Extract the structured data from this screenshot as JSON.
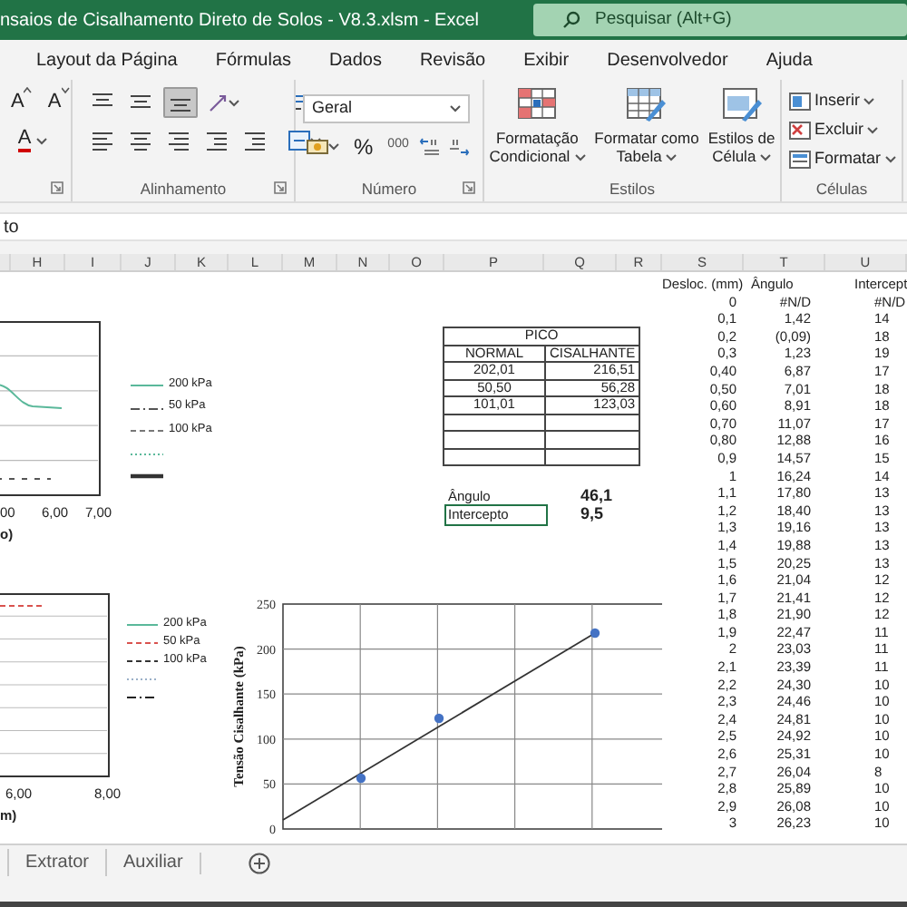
{
  "title_bar": {
    "title": "nsaios de Cisalhamento Direto de Solos - V8.3.xlsm  -  Excel",
    "search_placeholder": "Pesquisar (Alt+G)"
  },
  "ribbon_tabs": [
    "Layout da Página",
    "Fórmulas",
    "Dados",
    "Revisão",
    "Exibir",
    "Desenvolvedor",
    "Ajuda"
  ],
  "ribbon": {
    "font": {
      "grow": "A",
      "shrink": "A",
      "font_color_button": "A"
    },
    "alignment": {
      "vertical": [
        {
          "kind": "top",
          "selected": false
        },
        {
          "kind": "middle",
          "selected": false
        },
        {
          "kind": "bottom",
          "selected": true
        }
      ],
      "label": "Alinhamento"
    },
    "number": {
      "format": "Geral",
      "percent": "%",
      "thousands": "000",
      "label": "Número"
    },
    "styles": {
      "buttons": [
        "Formatação Condicional",
        "Formatar como Tabela",
        "Estilos de Célula"
      ],
      "label": "Estilos"
    },
    "cells": {
      "buttons": [
        "Inserir",
        "Excluir",
        "Formatar"
      ],
      "label": "Células"
    }
  },
  "formula_bar": {
    "value": "to"
  },
  "column_headers": [
    "H",
    "I",
    "J",
    "K",
    "L",
    "M",
    "N",
    "O",
    "P",
    "Q",
    "R",
    "S",
    "T",
    "U"
  ],
  "chart_top_left": {
    "x_tick_labels": [
      "00",
      "6,00",
      "7,00"
    ],
    "axis_label": "o)",
    "legend": [
      {
        "label": "200 kPa",
        "kind": "solid",
        "color": "#5ab89a"
      },
      {
        "label": "50 kPa",
        "kind": "dashdot",
        "color": "#555555"
      },
      {
        "label": "100 kPa",
        "kind": "dashed",
        "color": "#777777"
      },
      {
        "kind": "dotted",
        "color": "#5ab89a"
      },
      {
        "kind": "thick",
        "color": "#333333"
      }
    ]
  },
  "chart_bottom_left": {
    "x_tick_labels": [
      "6,00",
      "8,00"
    ],
    "axis_label": "m)",
    "legend": [
      {
        "label": "200 kPa",
        "kind": "solid",
        "color": "#5ab89a"
      },
      {
        "label": "50 kPa",
        "kind": "dashed",
        "color": "#d9534f"
      },
      {
        "label": "100 kPa",
        "kind": "dashed",
        "color": "#333333"
      },
      {
        "kind": "dotted",
        "color": "#9ab0c8"
      },
      {
        "kind": "dashdot",
        "color": "#222222"
      }
    ]
  },
  "strength_chart": {
    "axis_title": "Tensão Cisalhante (kPa)",
    "y_tick_labels": [
      "250",
      "200",
      "150",
      "100",
      "50",
      "0"
    ],
    "trendline": true
  },
  "peak_table": {
    "title": "PICO",
    "columns": [
      "NORMAL",
      "CISALHANTE"
    ],
    "rows": [
      [
        "202,01",
        "216,51"
      ],
      [
        "50,50",
        "56,28"
      ],
      [
        "101,01",
        "123,03"
      ]
    ]
  },
  "results": [
    {
      "label": "Ângulo",
      "value": "46,1",
      "selected": false
    },
    {
      "label": "Intercepto",
      "value": "9,5",
      "selected": true
    }
  ],
  "data_table": {
    "columns": [
      "Desloc. (mm)",
      "Ângulo",
      "Intercept"
    ],
    "rows": [
      [
        "0",
        "#N/D",
        "#N/D"
      ],
      [
        "0,1",
        "1,42",
        "14"
      ],
      [
        "0,2",
        "(0,09)",
        "18"
      ],
      [
        "0,3",
        "1,23",
        "19"
      ],
      [
        "0,40",
        "6,87",
        "17"
      ],
      [
        "0,50",
        "7,01",
        "18"
      ],
      [
        "0,60",
        "8,91",
        "18"
      ],
      [
        "0,70",
        "11,07",
        "17"
      ],
      [
        "0,80",
        "12,88",
        "16"
      ],
      [
        "0,9",
        "14,57",
        "15"
      ],
      [
        "1",
        "16,24",
        "14"
      ],
      [
        "1,1",
        "17,80",
        "13"
      ],
      [
        "1,2",
        "18,40",
        "13"
      ],
      [
        "1,3",
        "19,16",
        "13"
      ],
      [
        "1,4",
        "19,88",
        "13"
      ],
      [
        "1,5",
        "20,25",
        "13"
      ],
      [
        "1,6",
        "21,04",
        "12"
      ],
      [
        "1,7",
        "21,41",
        "12"
      ],
      [
        "1,8",
        "21,90",
        "12"
      ],
      [
        "1,9",
        "22,47",
        "11"
      ],
      [
        "2",
        "23,03",
        "11"
      ],
      [
        "2,1",
        "23,39",
        "11"
      ],
      [
        "2,2",
        "24,30",
        "10"
      ],
      [
        "2,3",
        "24,46",
        "10"
      ],
      [
        "2,4",
        "24,81",
        "10"
      ],
      [
        "2,5",
        "24,92",
        "10"
      ],
      [
        "2,6",
        "25,31",
        "10"
      ],
      [
        "2,7",
        "26,04",
        "8"
      ],
      [
        "2,8",
        "25,89",
        "10"
      ],
      [
        "2,9",
        "26,08",
        "10"
      ],
      [
        "3",
        "26,23",
        "10"
      ]
    ]
  },
  "sheet_tabs": [
    "Extrator",
    "Auxiliar"
  ]
}
